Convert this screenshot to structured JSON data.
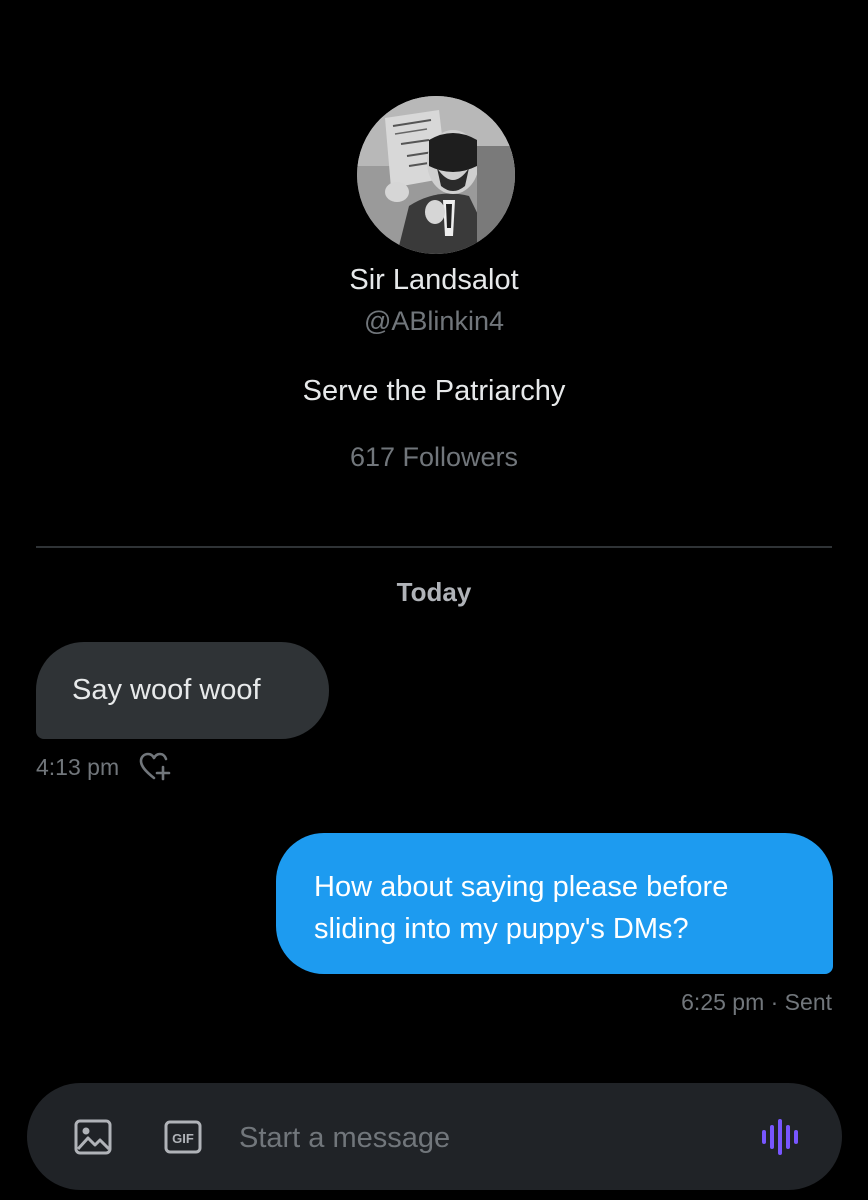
{
  "profile": {
    "avatar_icon": "profile-photo",
    "name": "Sir Landsalot",
    "handle": "@ABlinkin4",
    "bio": "Serve the Patriarchy",
    "followers": "617 Followers"
  },
  "conversation": {
    "date_label": "Today",
    "messages": [
      {
        "direction": "incoming",
        "text": "Say woof woof",
        "time": "4:13 pm",
        "reaction_icon": "heart-plus-icon"
      },
      {
        "direction": "outgoing",
        "text": "How about saying please before sliding into my puppy's DMs?",
        "meta": "6:25 pm · Sent"
      }
    ]
  },
  "composer": {
    "placeholder": "Start a message",
    "image_icon": "image-icon",
    "gif_icon": "gif-icon",
    "gif_label": "GIF",
    "voice_icon": "voice-message-icon"
  },
  "colors": {
    "background": "#000000",
    "incoming_bubble": "#2f3336",
    "outgoing_bubble": "#1d9bf0",
    "muted_text": "#71767b",
    "voice_accent": "#7856ff"
  }
}
